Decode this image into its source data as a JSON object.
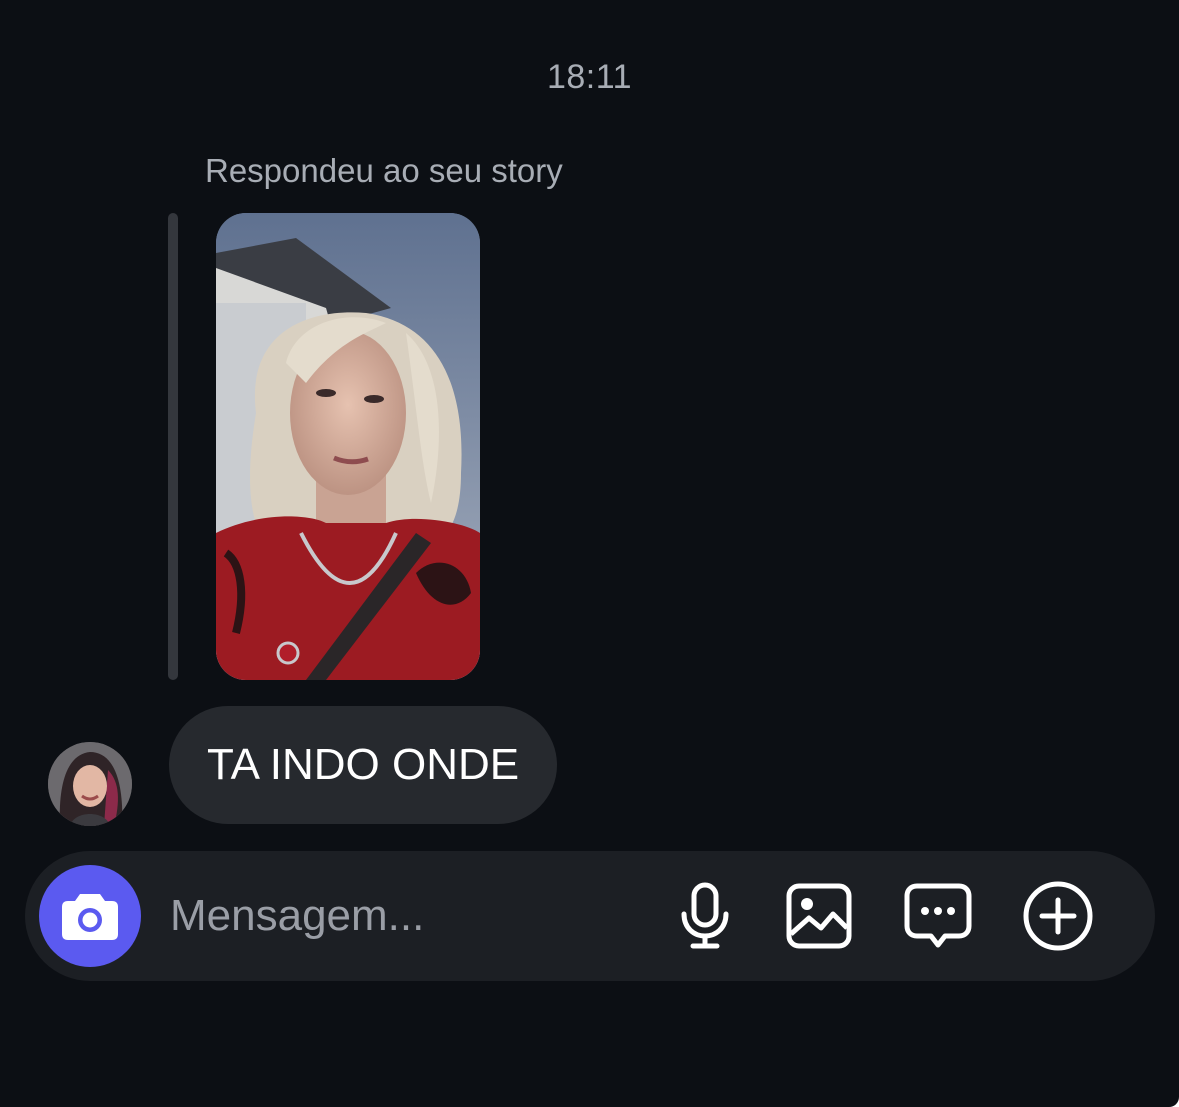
{
  "thread": {
    "timestamp": "18:11",
    "story_reply_label": "Respondeu ao seu story",
    "story_thumbnail": {
      "description_icon": "story-photo",
      "colors": {
        "sky": "#7c8ba3",
        "hair": "#d9cfbf",
        "shirt": "#9c1b22"
      }
    },
    "messages": [
      {
        "sender": "other",
        "text": "TA INDO ONDE",
        "avatar_icon": "avatar"
      }
    ]
  },
  "composer": {
    "placeholder": "Mensagem...",
    "value": "",
    "camera_icon": "camera-icon",
    "camera_color": "#5b5af0",
    "tools": [
      {
        "icon": "microphone-icon"
      },
      {
        "icon": "gallery-icon"
      },
      {
        "icon": "sticker-message-icon"
      },
      {
        "icon": "plus-circle-icon"
      }
    ]
  },
  "colors": {
    "background": "#0c0f14",
    "bubble": "#26292e",
    "composer": "#1c1f24",
    "secondary_text": "#a8adb5"
  }
}
